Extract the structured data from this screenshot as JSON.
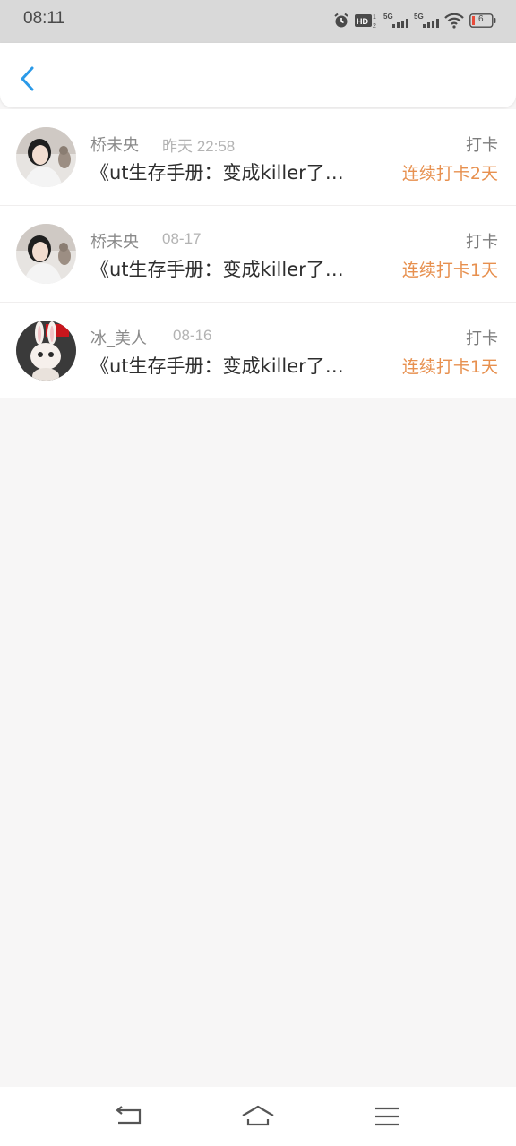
{
  "status_bar": {
    "time": "08:11",
    "battery": "6",
    "icons": [
      "alarm-icon",
      "hd-icon",
      "signal-5g-icon",
      "signal-5g-icon",
      "wifi-icon",
      "battery-icon"
    ]
  },
  "header": {
    "back_icon": "chevron-left-icon",
    "accent": "#2b9ae8"
  },
  "entries": [
    {
      "name": "桥未央",
      "time": "昨天 22:58",
      "type": "打卡",
      "title": "《ut生存手册：变成killer了…",
      "streak": "连续打卡2天"
    },
    {
      "name": "桥未央",
      "time": "08-17",
      "type": "打卡",
      "title": "《ut生存手册：变成killer了…",
      "streak": "连续打卡1天"
    },
    {
      "name": "冰_美人",
      "time": "08-16",
      "type": "打卡",
      "title": "《ut生存手册：变成killer了…",
      "streak": "连续打卡1天"
    }
  ],
  "nav_bar": {
    "icons": [
      "back-nav-icon",
      "home-nav-icon",
      "menu-nav-icon"
    ]
  },
  "colors": {
    "streak": "#e7904f",
    "accent": "#2b9ae8"
  }
}
